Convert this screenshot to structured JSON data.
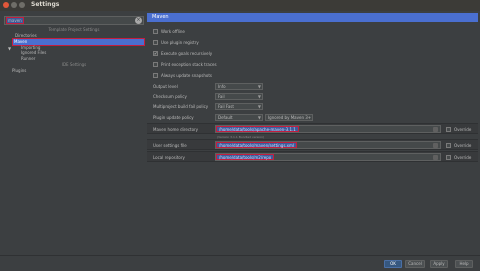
{
  "window": {
    "title": "Settings"
  },
  "sidebar": {
    "search_value": "maven",
    "template_header": "Template Project Settings",
    "items": [
      {
        "label": "Directories"
      },
      {
        "label": "Maven"
      },
      {
        "label": "Importing"
      },
      {
        "label": "Ignored Files"
      },
      {
        "label": "Runner"
      }
    ],
    "ide_header": "IDE Settings",
    "plugins_label": "Plugins"
  },
  "panel": {
    "title": "Maven",
    "checkboxes": [
      {
        "label": "Work offline",
        "checked": false
      },
      {
        "label": "Use plugin registry",
        "checked": false
      },
      {
        "label": "Execute goals recursively",
        "checked": true
      },
      {
        "label": "Print exception stack traces",
        "checked": false
      },
      {
        "label": "Always update snapshots",
        "checked": false
      }
    ],
    "output_level": {
      "label": "Output level",
      "value": "Info"
    },
    "checksum_policy": {
      "label": "Checksum policy",
      "value": "Fail"
    },
    "multiproject_policy": {
      "label": "Multiproject build fail policy",
      "value": "Fail Fast"
    },
    "plugin_update_policy": {
      "label": "Plugin update policy",
      "value": "Default",
      "extra": "Ignored by Maven 3+"
    },
    "maven_home": {
      "label": "Maven home directory",
      "value": "/home/data/tools/apache-maven-3.1.1",
      "hint": "(Version 3.1.1 Bundled version)"
    },
    "user_settings": {
      "label": "User settings file",
      "value": "/home/data/tools/maven/settings.xml"
    },
    "local_repo": {
      "label": "Local repository",
      "value": "/home/data/tools/m2/repo"
    },
    "override_label": "Override"
  },
  "footer": {
    "ok": "OK",
    "cancel": "Cancel",
    "apply": "Apply",
    "help": "Help"
  }
}
